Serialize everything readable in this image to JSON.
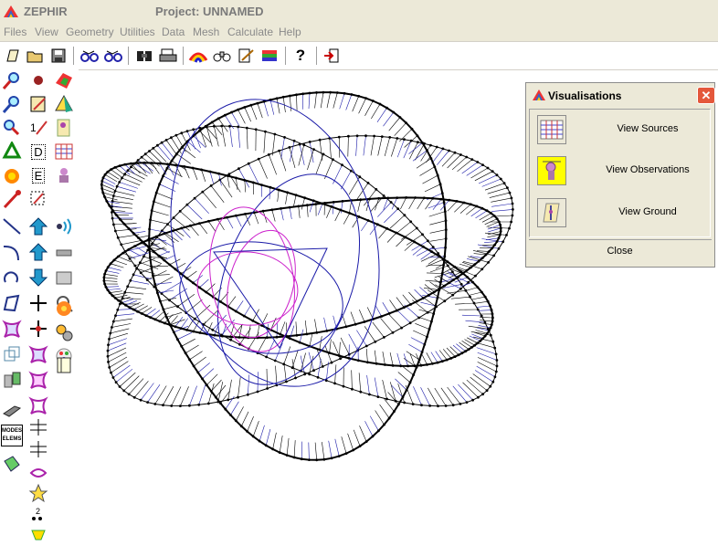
{
  "window": {
    "app_name": "ZEPHIR",
    "project_title": "Project: UNNAMED"
  },
  "menu": [
    "Files",
    "View",
    "Geometry",
    "Utilities",
    "Data",
    "Mesh",
    "Calculate",
    "Help"
  ],
  "toolbar_icons": [
    "new-file-icon",
    "open-folder-icon",
    "save-disk-icon",
    "link-icon",
    "unlink-icon",
    "cut-icon",
    "print-icon",
    "rainbow-icon",
    "binoculars-icon",
    "edit-icon",
    "stack-icon",
    "help-icon",
    "exit-icon"
  ],
  "toolbar_help_glyph": "?",
  "dialog": {
    "title": "Visualisations",
    "close_glyph": "✕",
    "items": [
      {
        "label": "View Sources",
        "icon": "view-sources-icon"
      },
      {
        "label": "View Observations",
        "icon": "view-observations-icon"
      },
      {
        "label": "View Ground",
        "icon": "view-ground-icon"
      }
    ],
    "close_label": "Close"
  },
  "side_labels": {
    "d": "D",
    "e": "E",
    "modes": "MODES",
    "elems": "ELEMS"
  },
  "colors": {
    "menu_bg": "#ece9d8",
    "highlight": "#ffff00",
    "mesh_black": "#000000",
    "mesh_blue": "#1a1aa8",
    "mesh_magenta": "#cc22cc"
  }
}
